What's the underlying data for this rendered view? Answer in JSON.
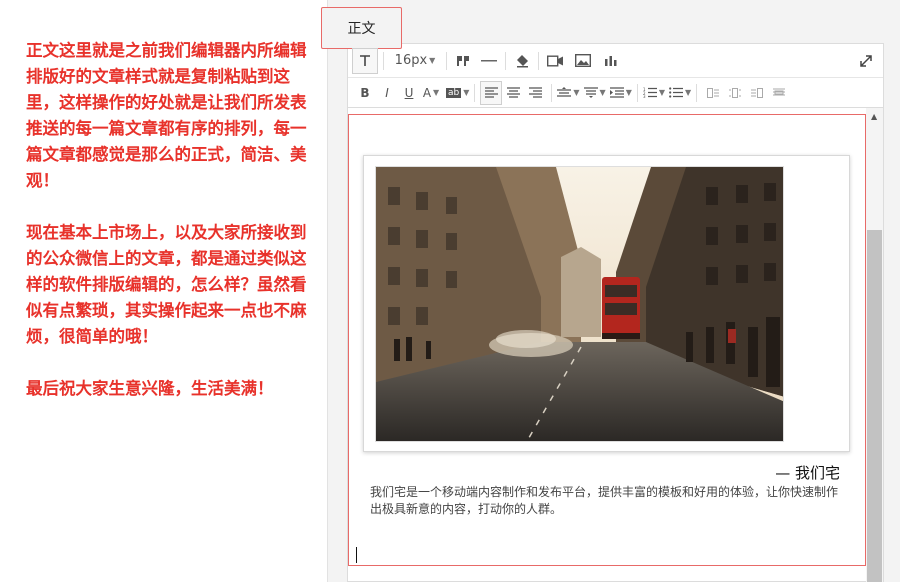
{
  "annotation": {
    "paragraph1": "正文这里就是之前我们编辑器内所编辑排版好的文章样式就是复制粘贴到这里，这样操作的好处就是让我们所发表推送的每一篇文章都有序的排列，每一篇文章都感觉是那么的正式，简洁、美观！",
    "paragraph2": "现在基本上市场上，以及大家所接收到的公众微信上的文章，都是通过类似这样的软件排版编辑的，怎么样？虽然看似有点繁琐，其实操作起来一点也不麻烦，很简单的哦！",
    "paragraph3": "最后祝大家生意兴隆，生活美满！",
    "color": "#e8322b"
  },
  "editor": {
    "tab_label": "正文",
    "font_size": "16px",
    "toolbar_row1": [
      "format-text-icon",
      "font-size-select",
      "blockquote-icon",
      "horizontal-rule-icon",
      "clear-format-icon",
      "video-icon",
      "image-icon",
      "chart-icon",
      "expand-icon"
    ],
    "toolbar_row2": [
      "bold-icon",
      "italic-icon",
      "underline-icon",
      "font-color-icon",
      "background-color-icon",
      "align-left-icon",
      "align-center-icon",
      "align-right-icon",
      "line-height-icon",
      "paragraph-spacing-icon",
      "indent-icon",
      "ordered-list-icon",
      "unordered-list-icon",
      "table-icons"
    ],
    "content": {
      "image_alt": "city street photo",
      "caption_title": "— 我们宅",
      "caption_body": "我们宅是一个移动端内容制作和发布平台，提供丰富的模板和好用的体验，让你快速制作出极具新意的内容，打动你的人群。"
    },
    "highlight_color": "#e86a68"
  }
}
